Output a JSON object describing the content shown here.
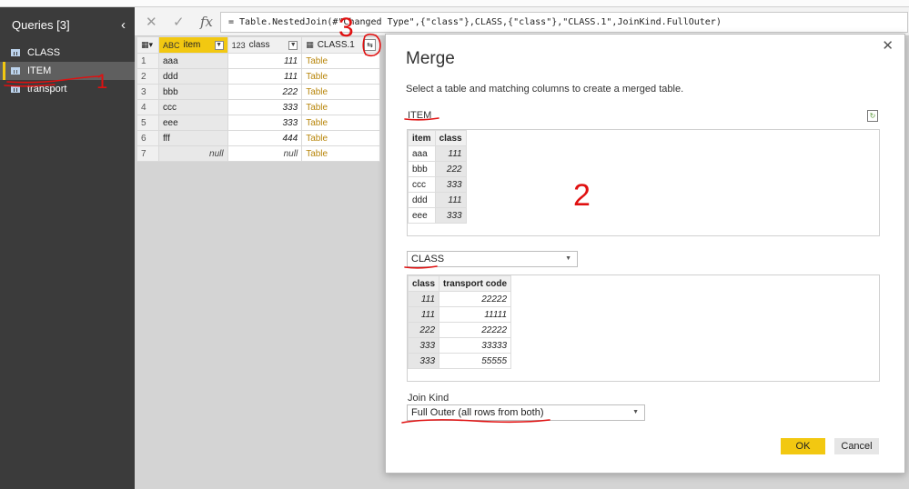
{
  "queries_pane": {
    "title": "Queries [3]",
    "collapse_icon": "chevron-left-icon",
    "items": [
      {
        "label": "CLASS",
        "selected": false
      },
      {
        "label": "ITEM",
        "selected": true
      },
      {
        "label": "transport",
        "selected": false
      }
    ]
  },
  "formula_bar": {
    "cancel_icon": "✕",
    "apply_icon": "✓",
    "fx_label": "fx",
    "formula": "= Table.NestedJoin(#\"Changed Type\",{\"class\"},CLASS,{\"class\"},\"CLASS.1\",JoinKind.FullOuter)"
  },
  "grid": {
    "columns": [
      {
        "type_icon": "ABC",
        "label": "item"
      },
      {
        "type_icon": "123",
        "label": "class"
      },
      {
        "type_icon": "table-icon",
        "label": "CLASS.1"
      }
    ],
    "rows": [
      {
        "n": "1",
        "item": "aaa",
        "class": "111",
        "link": "Table"
      },
      {
        "n": "2",
        "item": "ddd",
        "class": "111",
        "link": "Table"
      },
      {
        "n": "3",
        "item": "bbb",
        "class": "222",
        "link": "Table"
      },
      {
        "n": "4",
        "item": "ccc",
        "class": "333",
        "link": "Table"
      },
      {
        "n": "5",
        "item": "eee",
        "class": "333",
        "link": "Table"
      },
      {
        "n": "6",
        "item": "fff",
        "class": "444",
        "link": "Table"
      },
      {
        "n": "7",
        "item": "null",
        "class": "null",
        "link": "Table"
      }
    ]
  },
  "merge_dialog": {
    "title": "Merge",
    "description": "Select a table and matching columns to create a merged table.",
    "first_table_label": "ITEM",
    "first_preview": {
      "headers": [
        "item",
        "class"
      ],
      "rows": [
        [
          "aaa",
          "111"
        ],
        [
          "bbb",
          "222"
        ],
        [
          "ccc",
          "333"
        ],
        [
          "ddd",
          "111"
        ],
        [
          "eee",
          "333"
        ]
      ]
    },
    "second_table_select": "CLASS",
    "second_preview": {
      "headers": [
        "class",
        "transport code"
      ],
      "rows": [
        [
          "111",
          "22222"
        ],
        [
          "111",
          "11111"
        ],
        [
          "222",
          "22222"
        ],
        [
          "333",
          "33333"
        ],
        [
          "333",
          "55555"
        ]
      ]
    },
    "join_kind_label": "Join Kind",
    "join_kind_value": "Full Outer (all rows from both)",
    "ok_label": "OK",
    "cancel_label": "Cancel"
  },
  "annotations": {
    "mark_1": "1",
    "mark_2": "2",
    "mark_3": "3"
  },
  "colors": {
    "accent": "#f2c811",
    "annotation": "#e01010",
    "pane_bg": "#3b3b3b"
  }
}
